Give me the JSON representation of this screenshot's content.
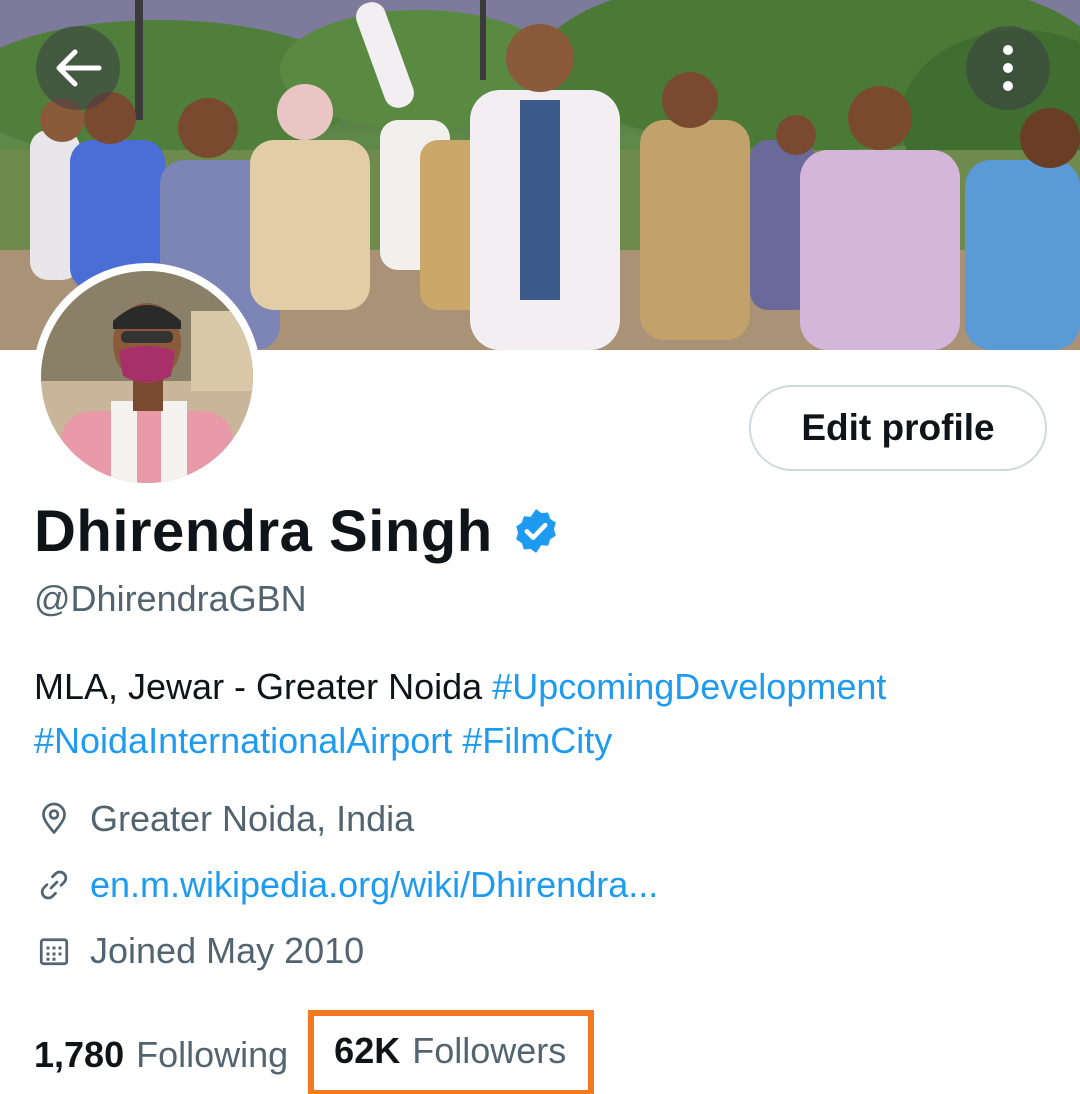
{
  "header": {
    "back_icon": "arrow-left-icon",
    "more_icon": "more-vertical-icon"
  },
  "profile": {
    "display_name": "Dhirendra Singh",
    "verified": true,
    "verified_color": "#1d9bf0",
    "handle": "@DhirendraGBN",
    "edit_label": "Edit profile",
    "bio": {
      "text": "MLA, Jewar - Greater Noida",
      "hashtags": [
        "#UpcomingDevelopment",
        "#NoidaInternationalAirport",
        "#FilmCity"
      ]
    },
    "location": "Greater Noida, India",
    "website": "en.m.wikipedia.org/wiki/Dhirendra...",
    "joined": "Joined May 2010",
    "following_count": "1,780",
    "following_label": "Following",
    "followers_count": "62K",
    "followers_label": "Followers",
    "highlight_color": "#f47a20"
  }
}
